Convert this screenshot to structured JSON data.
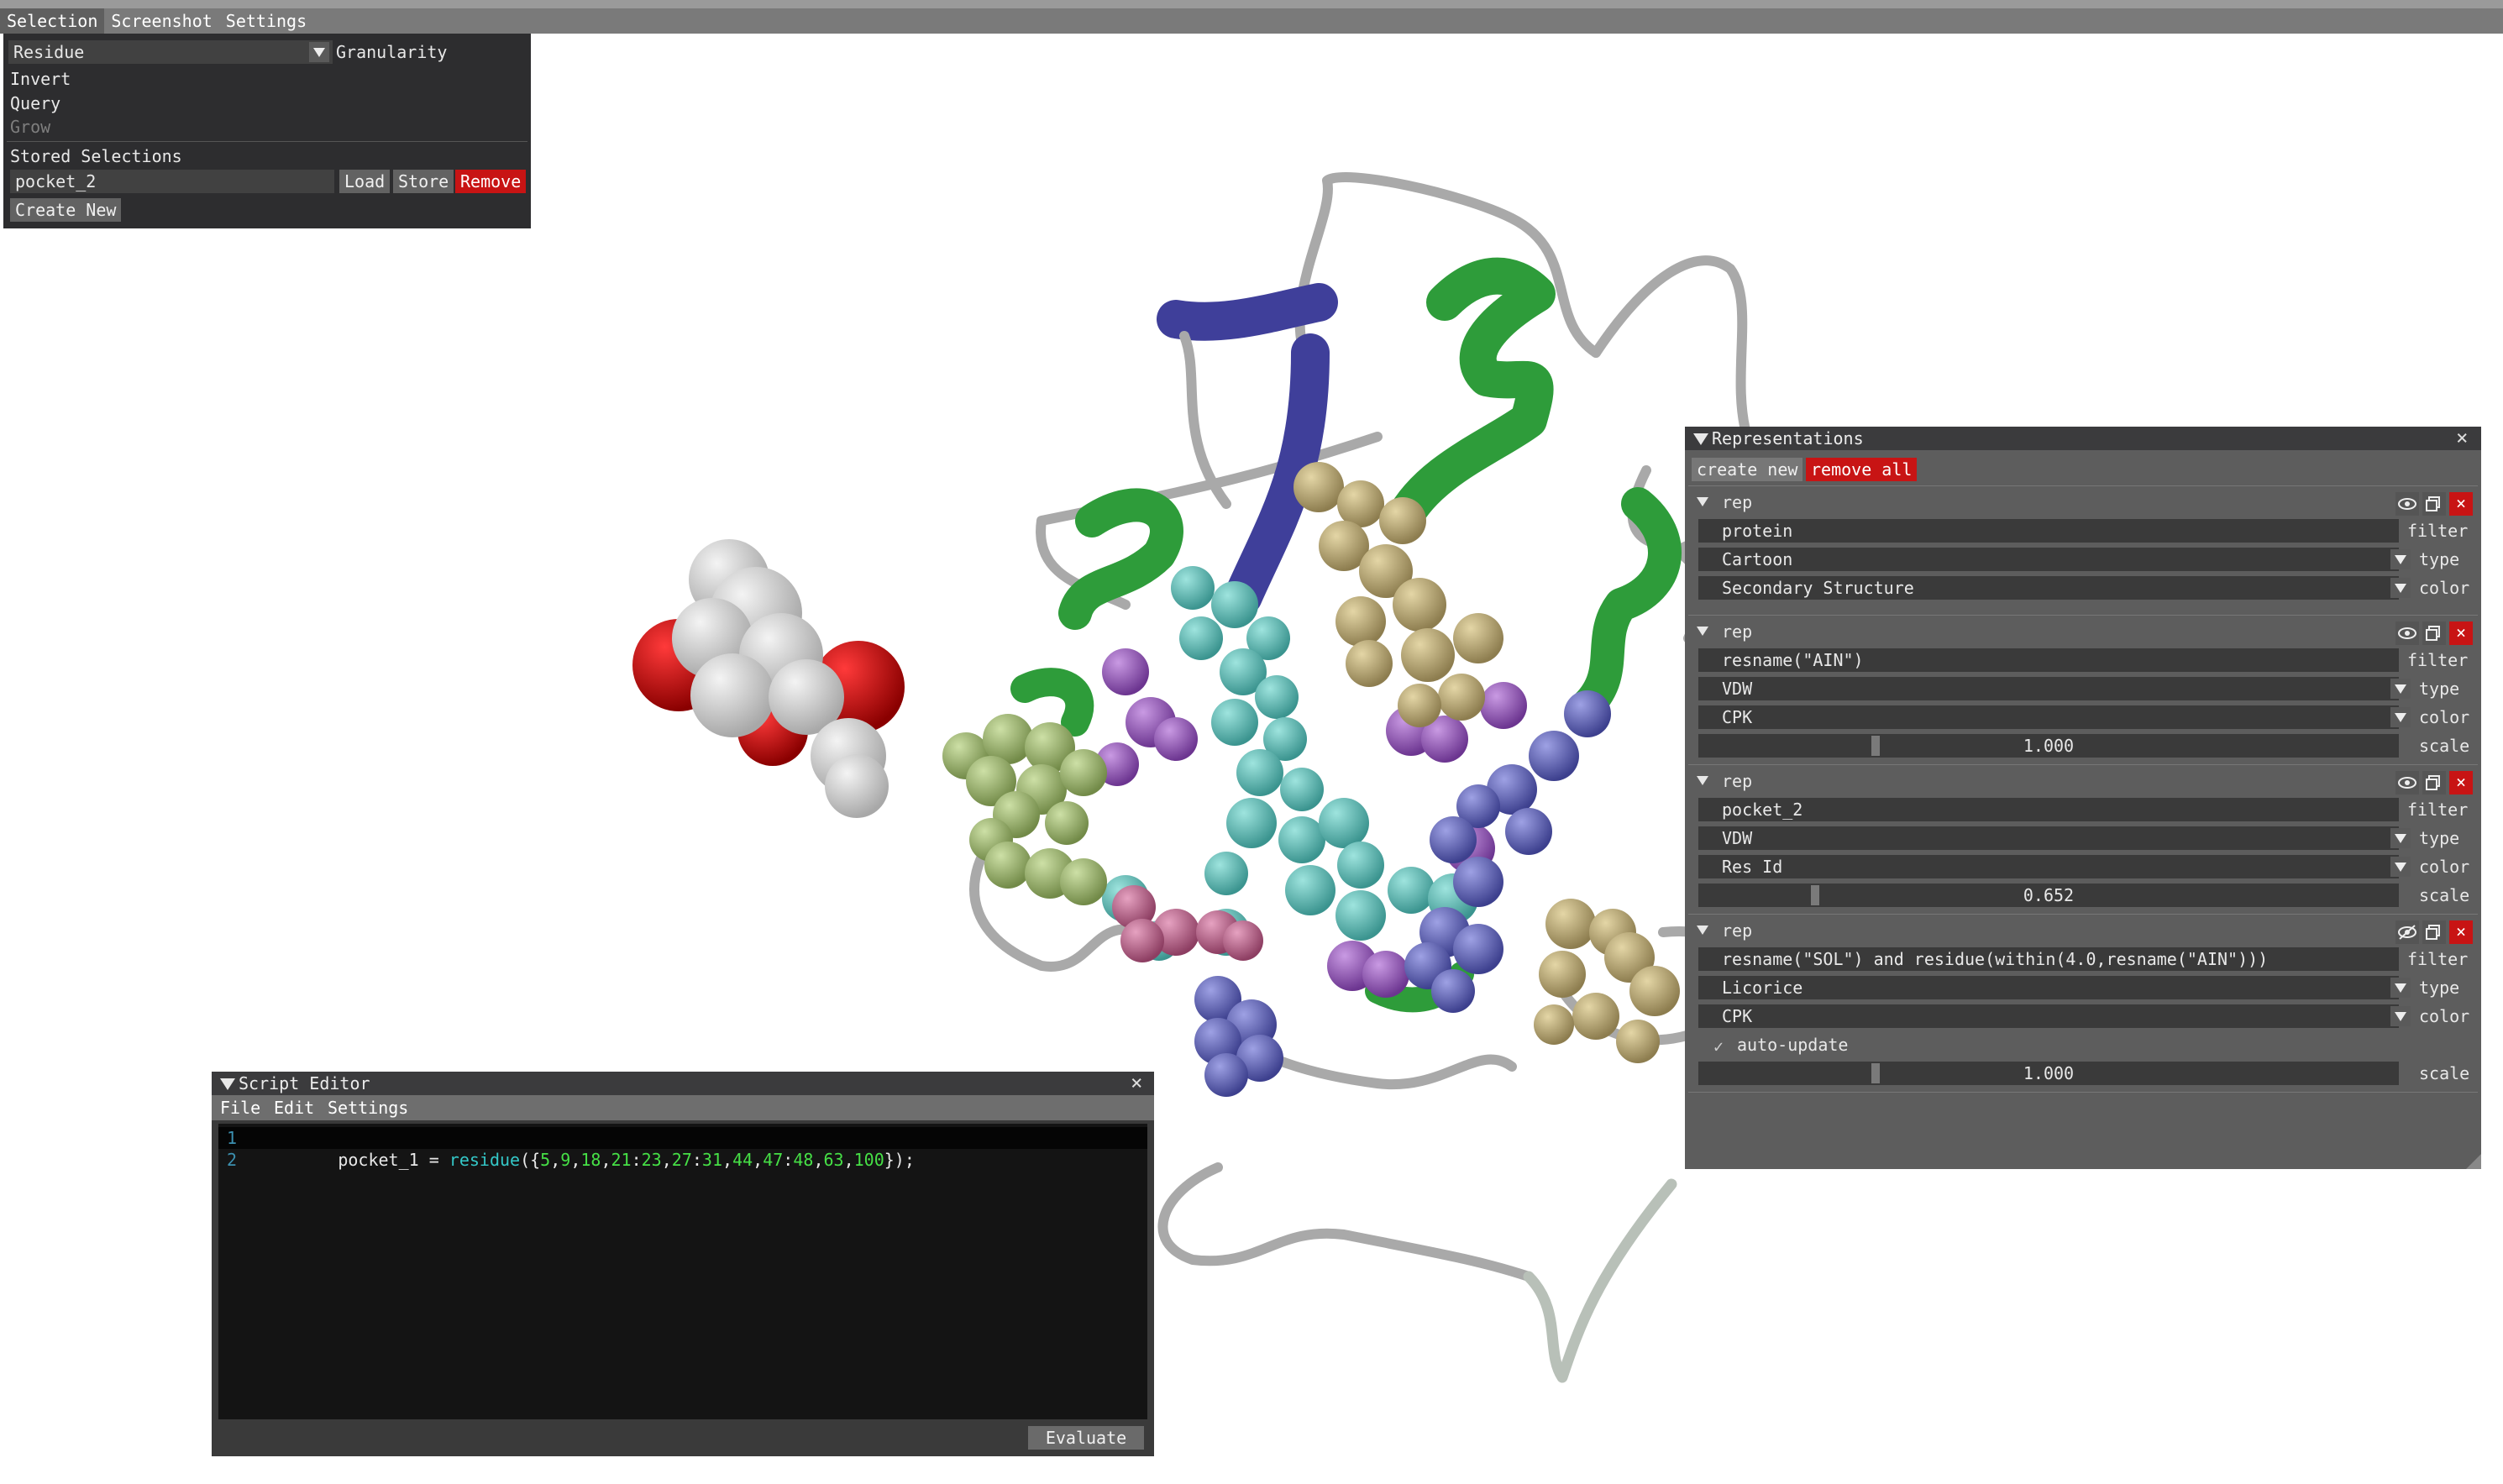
{
  "menubar": {
    "items": [
      "Selection",
      "Screenshot",
      "Settings"
    ],
    "active": "Selection"
  },
  "selection_panel": {
    "granularity_value": "Residue",
    "granularity_label": "Granularity",
    "items": [
      "Invert",
      "Query",
      "Grow"
    ],
    "stored_header": "Stored Selections",
    "stored_name": "pocket_2",
    "load_label": "Load",
    "store_label": "Store",
    "remove_label": "Remove",
    "create_new_label": "Create New"
  },
  "representations": {
    "title": "Representations",
    "create_new_label": "create new",
    "remove_all_label": "remove all",
    "reps": [
      {
        "name": "rep",
        "filter": "protein",
        "type": "Cartoon",
        "color": "Secondary Structure",
        "scale": null,
        "visible": true
      },
      {
        "name": "rep",
        "filter": "resname(\"AIN\")",
        "type": "VDW",
        "color": "CPK",
        "scale": "1.000",
        "visible": true
      },
      {
        "name": "rep",
        "filter": "pocket_2",
        "type": "VDW",
        "color": "Res Id",
        "scale": "0.652",
        "visible": true
      },
      {
        "name": "rep",
        "filter": "resname(\"SOL\") and residue(within(4.0,resname(\"AIN\")))",
        "type": "Licorice",
        "color": "CPK",
        "auto_update": "auto-update",
        "scale": "1.000",
        "visible": false
      }
    ],
    "labels": {
      "filter": "filter",
      "type": "type",
      "color": "color",
      "scale": "scale"
    }
  },
  "script_editor": {
    "title": "Script Editor",
    "menu": [
      "File",
      "Edit",
      "Settings"
    ],
    "lines": [
      "1",
      "2"
    ],
    "code_var": "pocket_1",
    "code_eq": " = ",
    "code_fn": "residue",
    "code_open": "({",
    "code_nums": [
      "5",
      "9",
      "18",
      "21",
      "23",
      "27",
      "31",
      "44",
      "47",
      "48",
      "63",
      "100"
    ],
    "code_close": "});",
    "evaluate_label": "Evaluate"
  },
  "colors": {
    "helix_green": "#2e9c3a",
    "strand_blue": "#3f3f9a",
    "coil_gray": "#a8a8a8",
    "teal": "#5fc3bd",
    "tan": "#c0ad77",
    "purple": "#9b5bc1",
    "indigo": "#6366c0",
    "olive": "#a2bd72",
    "pink": "#c56c93",
    "oxygen_red": "#d00000",
    "carbon_white": "#d7d7d7"
  }
}
